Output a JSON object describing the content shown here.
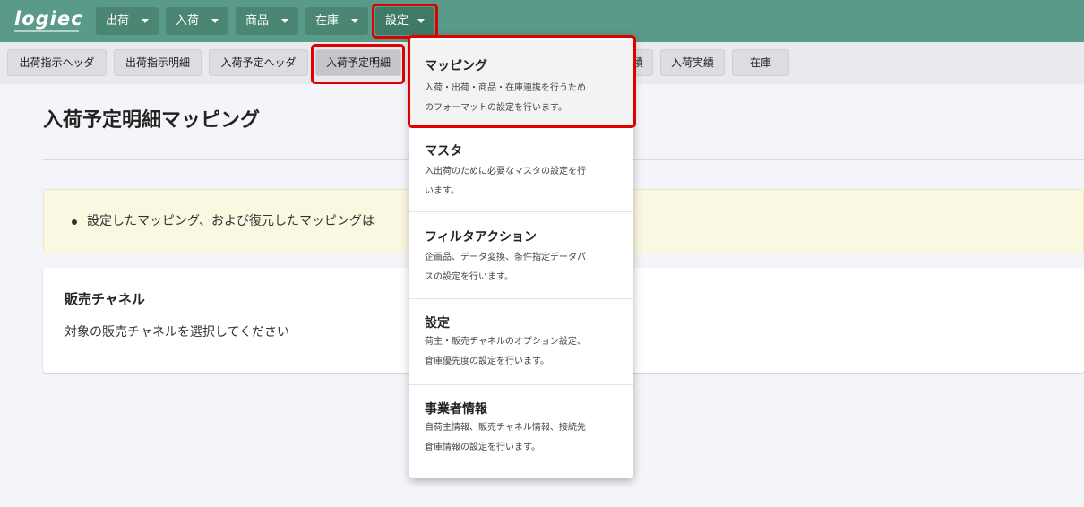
{
  "app": {
    "logo_text": "logiec"
  },
  "nav": {
    "items": [
      {
        "label": "出荷"
      },
      {
        "label": "入荷"
      },
      {
        "label": "商品"
      },
      {
        "label": "在庫"
      },
      {
        "label": "設定"
      }
    ]
  },
  "subnav": {
    "items": [
      {
        "label": "出荷指示ヘッダ"
      },
      {
        "label": "出荷指示明細"
      },
      {
        "label": "入荷予定ヘッダ"
      },
      {
        "label": "入荷予定明細"
      },
      {
        "label": "積"
      },
      {
        "label": "入荷実績"
      },
      {
        "label": "在庫"
      }
    ]
  },
  "page": {
    "title": "入荷予定明細マッピング",
    "notice": "設定したマッピング、および復元したマッピングは"
  },
  "card": {
    "title": "販売チャネル",
    "description": "対象の販売チャネルを選択してください"
  },
  "dropdown": {
    "items": [
      {
        "title": "マッピング",
        "desc_lines": [
          "入荷・出荷・商品・在庫連携を行うため",
          "のフォーマットの設定を行います。"
        ]
      },
      {
        "title": "マスタ",
        "desc_lines": [
          "入出荷のために必要なマスタの設定を行",
          "います。"
        ]
      },
      {
        "title": "フィルタアクション",
        "desc_lines": [
          "企画品、データ変換、条件指定データパ",
          "スの設定を行います。"
        ]
      },
      {
        "title": "設定",
        "desc_lines": [
          "荷主・販売チャネルのオプション設定、",
          "倉庫優先度の設定を行います。"
        ]
      },
      {
        "title": "事業者情報",
        "desc_lines": [
          "自荷主情報、販売チャネル情報、接続先",
          "倉庫情報の設定を行います。"
        ]
      }
    ]
  },
  "colors": {
    "topbar": "#5a9a88",
    "highlight": "#e00000"
  }
}
